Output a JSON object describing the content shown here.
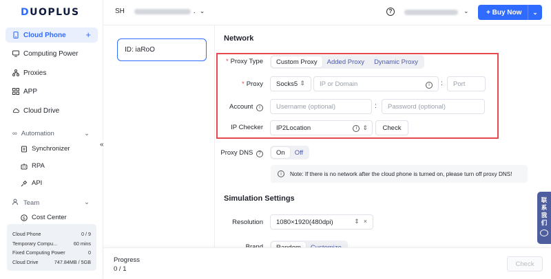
{
  "app": {
    "logo": "DUOPLUS",
    "accent_color": "#2f6bff",
    "highlight_color": "#e5484d"
  },
  "sidebar": {
    "items": [
      {
        "label": "Cloud Phone",
        "icon": "phone-icon",
        "active": true
      },
      {
        "label": "Computing Power",
        "icon": "monitor-icon"
      },
      {
        "label": "Proxies",
        "icon": "network-icon"
      },
      {
        "label": "APP",
        "icon": "grid-icon"
      },
      {
        "label": "Cloud Drive",
        "icon": "cloud-icon"
      }
    ],
    "automation": {
      "title": "Automation",
      "items": [
        "Synchronizer",
        "RPA",
        "API"
      ]
    },
    "team": {
      "title": "Team",
      "items": [
        "Cost Center"
      ]
    },
    "collapse_glyph": "«",
    "stats": [
      {
        "label": "Cloud Phone",
        "value": "0 / 9"
      },
      {
        "label": "Temporary Compu...",
        "value": "60 mins"
      },
      {
        "label": "Fixed Computing Power",
        "value": "0"
      },
      {
        "label": "Cloud Drive",
        "value": "747.84MB / 5GB"
      }
    ]
  },
  "topbar": {
    "workspace_initials": "SH",
    "workspace_suffix": ".",
    "buy_label": "+ Buy Now"
  },
  "device": {
    "id_label": "ID: iaRoO"
  },
  "network": {
    "title": "Network",
    "proxy_type": {
      "label": "Proxy Type",
      "options": [
        "Custom Proxy",
        "Added Proxy",
        "Dynamic Proxy"
      ],
      "selected": "Custom Proxy"
    },
    "proxy": {
      "label": "Proxy",
      "protocol": "Socks5",
      "host_placeholder": "IP or Domain",
      "port_placeholder": "Port"
    },
    "account": {
      "label": "Account",
      "username_placeholder": "Username (optional)",
      "password_placeholder": "Password (optional)"
    },
    "ip_checker": {
      "label": "IP Checker",
      "value": "IP2Location",
      "check_label": "Check"
    },
    "proxy_dns": {
      "label": "Proxy DNS",
      "options": [
        "On",
        "Off"
      ],
      "selected": "On"
    },
    "note": "Note: If there is no network after the cloud phone is turned on, please turn off proxy DNS!"
  },
  "simulation": {
    "title": "Simulation Settings",
    "resolution": {
      "label": "Resolution",
      "value": "1080×1920(480dpi)"
    },
    "brand": {
      "label": "Brand",
      "options": [
        "Random",
        "Customize"
      ],
      "selected": "Random"
    }
  },
  "contact": {
    "label": "联系我们"
  },
  "bottombar": {
    "progress_label": "Progress",
    "progress_value": "0 / 1",
    "check_label": "Check"
  }
}
